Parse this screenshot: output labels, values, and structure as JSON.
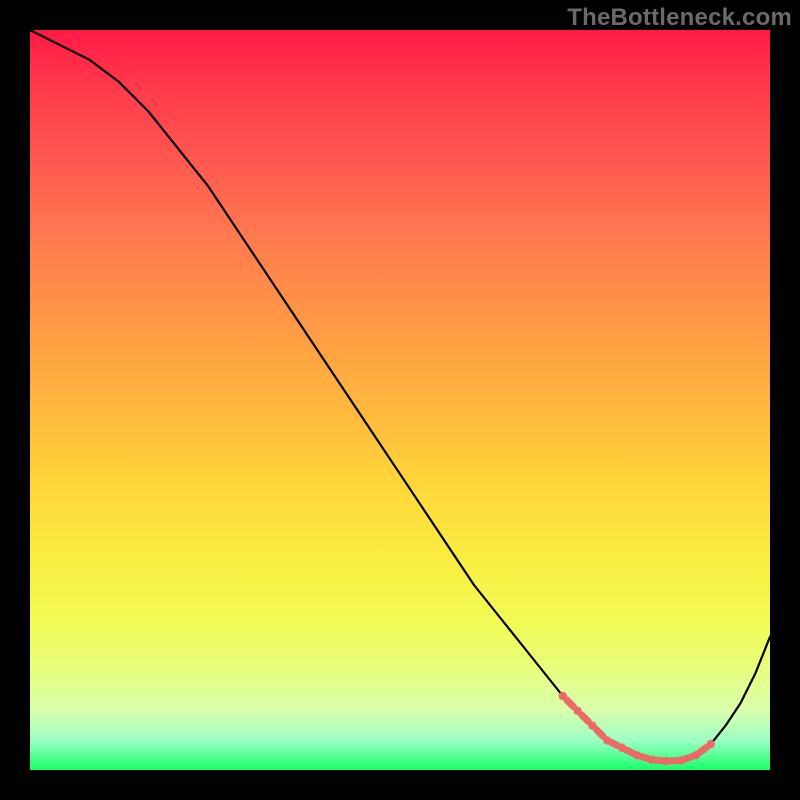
{
  "watermark": "TheBottleneck.com",
  "chart_data": {
    "type": "line",
    "title": "",
    "xlabel": "",
    "ylabel": "",
    "xlim": [
      0,
      100
    ],
    "ylim": [
      0,
      100
    ],
    "x": [
      0,
      4,
      8,
      12,
      16,
      20,
      24,
      28,
      32,
      36,
      40,
      44,
      48,
      52,
      56,
      60,
      64,
      68,
      72,
      74,
      76,
      78,
      80,
      82,
      84,
      86,
      88,
      90,
      92,
      94,
      96,
      98,
      100
    ],
    "y": [
      100,
      98,
      96,
      93,
      89,
      84,
      79,
      73,
      67,
      61,
      55,
      49,
      43,
      37,
      31,
      25,
      20,
      15,
      10,
      8,
      6,
      4,
      3,
      2,
      1.4,
      1.2,
      1.3,
      2,
      3.5,
      6,
      9,
      13,
      18
    ],
    "markers_x": [
      72,
      74,
      76,
      78,
      80,
      82,
      84,
      86,
      88,
      90,
      92
    ],
    "markers_y": [
      10,
      8,
      6,
      4,
      3,
      2,
      1.4,
      1.2,
      1.3,
      2,
      3.5
    ],
    "colors": {
      "curve": "#000000",
      "markers": "#ec6a66"
    }
  }
}
